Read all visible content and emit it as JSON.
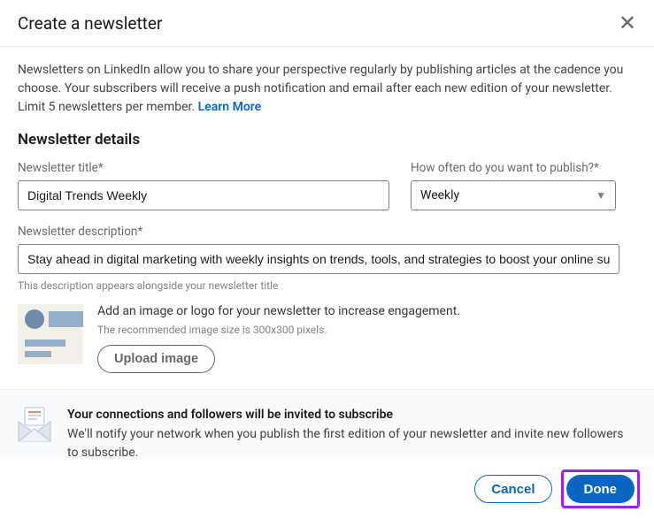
{
  "header": {
    "title": "Create a newsletter"
  },
  "intro": {
    "text": "Newsletters on LinkedIn allow you to share your perspective regularly by publishing articles at the cadence you choose. Your subscribers will receive a push notification and email after each new edition of your newsletter. Limit 5 newsletters per member. ",
    "learn_more": "Learn More"
  },
  "section_heading": "Newsletter details",
  "fields": {
    "title": {
      "label": "Newsletter title*",
      "value": "Digital Trends Weekly"
    },
    "frequency": {
      "label": "How often do you want to publish?*",
      "value": "Weekly"
    },
    "description": {
      "label": "Newsletter description*",
      "value": "Stay ahead in digital marketing with weekly insights on trends, tools, and strategies to boost your online success.",
      "hint": "This description appears alongside your newsletter title"
    }
  },
  "upload": {
    "title": "Add an image or logo for your newsletter to increase engagement.",
    "sub": "The recommended image size is 300x300 pixels.",
    "button": "Upload image"
  },
  "notice": {
    "title": "Your connections and followers will be invited to subscribe",
    "body": "We'll notify your network when you publish the first edition of your newsletter and invite new followers to subscribe."
  },
  "footer": {
    "cancel": "Cancel",
    "done": "Done"
  }
}
